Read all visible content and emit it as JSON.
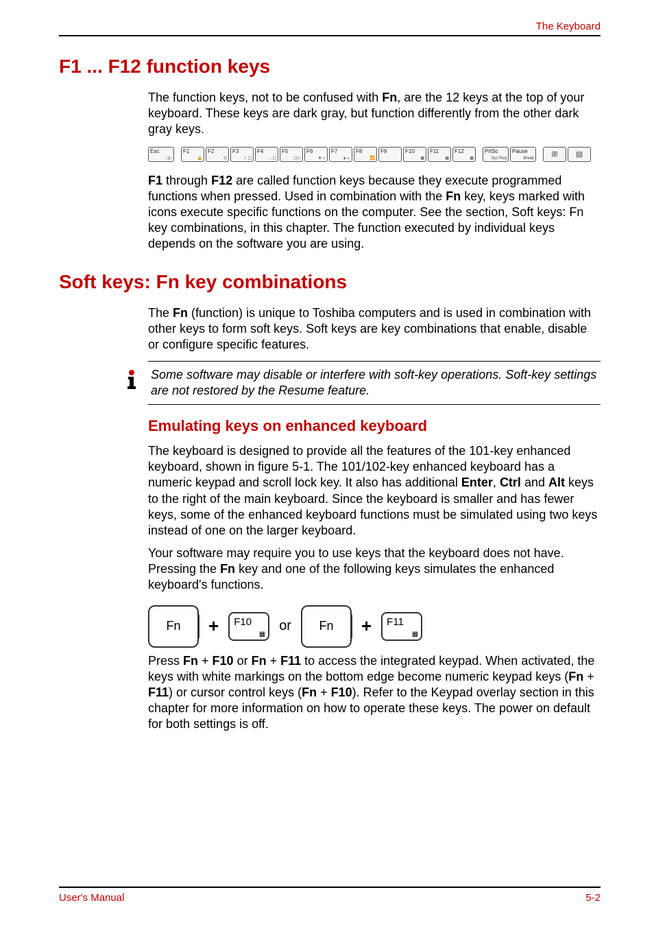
{
  "header": {
    "right": "The Keyboard"
  },
  "section1": {
    "title": "F1 ... F12 function keys",
    "p1_a": "The function keys, not to be confused with ",
    "p1_b": "Fn",
    "p1_c": ", are the 12 keys at the top of your keyboard. These keys are dark gray, but function differently from the other dark gray keys.",
    "p2_a": "F1",
    "p2_b": " through ",
    "p2_c": "F12",
    "p2_d": " are called function keys because they execute programmed functions when pressed. Used in combination with the ",
    "p2_e": "Fn",
    "p2_f": " key, keys marked with icons execute specific functions on the computer. See the section, Soft keys: Fn key combinations, in this chapter. The function executed by individual keys depends on the software you are using."
  },
  "fkeys": {
    "esc": "Esc",
    "keys": [
      "F1",
      "F2",
      "F3",
      "F4",
      "F5",
      "F6",
      "F7",
      "F8",
      "F9",
      "F10",
      "F11",
      "F12"
    ],
    "prtsc_top": "PrtSc",
    "prtsc_sub": "Sys Req",
    "pause_top": "Pause",
    "pause_sub": "Break"
  },
  "section2": {
    "title": "Soft keys: Fn key combinations",
    "p1_a": "The ",
    "p1_b": "Fn",
    "p1_c": " (function) is unique to Toshiba computers and is used in combination with other keys to form soft keys. Soft keys are key combinations that enable, disable or configure specific features.",
    "note": "Some software may disable or interfere with soft-key operations. Soft-key settings are not restored by the Resume feature.",
    "sub_title": "Emulating keys on enhanced keyboard",
    "p2_a": "The keyboard is designed to provide all the features of the 101-key enhanced keyboard, shown in figure 5-1. The 101/102-key enhanced keyboard has a numeric keypad and scroll lock key. It also has additional ",
    "p2_b": "Enter",
    "p2_c": ", ",
    "p2_d": "Ctrl",
    "p2_e": " and ",
    "p2_f": "Alt",
    "p2_g": " keys to the right of the main keyboard. Since the keyboard is smaller and has fewer keys, some of the enhanced keyboard functions must be simulated using two keys instead of one on the larger keyboard.",
    "p3_a": "Your software may require you to use keys that the keyboard does not have. Pressing the ",
    "p3_b": "Fn",
    "p3_c": " key and one of the following keys simulates the enhanced keyboard's functions.",
    "combo": {
      "fn": "Fn",
      "plus": "+",
      "f10": "F10",
      "or": "or",
      "f11": "F11"
    },
    "p4_a": "Press ",
    "p4_b": "Fn",
    "p4_c": " + ",
    "p4_d": "F10",
    "p4_e": " or ",
    "p4_f": "Fn",
    "p4_g": " + ",
    "p4_h": "F11",
    "p4_i": " to access the integrated keypad. When activated, the keys with white markings on the bottom edge become numeric keypad keys (",
    "p4_j": "Fn",
    "p4_k": " + ",
    "p4_l": "F11",
    "p4_m": ") or cursor control keys (",
    "p4_n": "Fn",
    "p4_o": " + ",
    "p4_p": "F10",
    "p4_q": "). Refer to the Keypad overlay section in this chapter for more information on how to operate these keys. The power on default for both settings is off."
  },
  "footer": {
    "left": "User's Manual",
    "right": "5-2"
  }
}
